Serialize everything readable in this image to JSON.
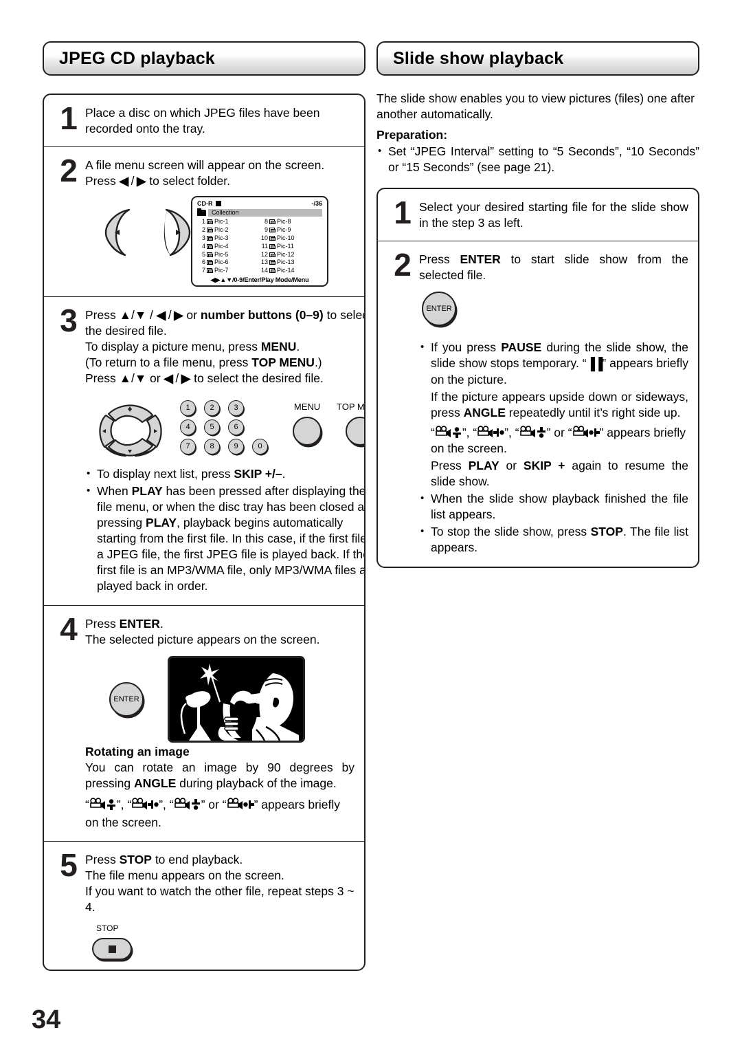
{
  "page_number": "34",
  "left": {
    "header": "JPEG CD playback",
    "steps": [
      {
        "num": "1",
        "lines": [
          "Place a disc on which JPEG files have been recorded onto the tray."
        ]
      },
      {
        "num": "2",
        "line1": "A file menu screen will appear on the screen.",
        "line2_pre": "Press ",
        "line2_post": " to select folder."
      },
      {
        "num": "3",
        "l1a": "Press ",
        "l1b": " / ",
        "l1c": " or ",
        "l1d": "number buttons (0–9)",
        "l1e": " to select the desired file.",
        "l2a": "To display a picture menu, press ",
        "l2b": "MENU",
        "l2c": ".",
        "l3a": "(To return to a file menu, press ",
        "l3b": "TOP MENU",
        "l3c": ".)",
        "l4a": "Press ",
        "l4b": " or ",
        "l4c": " to select the desired file.",
        "bullets": [
          {
            "a": "To display next list, press ",
            "b": "SKIP +/–",
            "c": "."
          },
          {
            "a": "When ",
            "b": "PLAY",
            "c": " has been pressed after displaying the file menu, or when the disc tray has been closed after pressing ",
            "d": "PLAY",
            "e": ", playback begins automatically starting from the first file. In this case, if the first file is a JPEG file, the first JPEG file is played back. If the first file is an MP3/WMA file, only MP3/WMA files are played back in order."
          }
        ]
      },
      {
        "num": "4",
        "l1a": "Press ",
        "l1b": "ENTER",
        "l1c": ".",
        "l2": "The selected picture appears on the screen.",
        "enter_label": "ENTER",
        "rotate_head": "Rotating an image",
        "rotate_t1": "You can rotate an image by 90 degrees by pressing ",
        "rotate_t2": "ANGLE",
        "rotate_t3": " during playback of the image.",
        "rotate_t4": " appears briefly on the screen."
      },
      {
        "num": "5",
        "l1a": "Press ",
        "l1b": "STOP",
        "l1c": " to end playback.",
        "l2": "The file menu appears on the screen.",
        "l3": "If you want to watch the other file, repeat steps 3 ~ 4.",
        "stop_label": "STOP"
      }
    ],
    "osd": {
      "disc_type": "CD-R",
      "counter": "-/36",
      "folder": "Collection",
      "files_left": [
        {
          "idx": "1",
          "name": "Pic-1"
        },
        {
          "idx": "2",
          "name": "Pic-2"
        },
        {
          "idx": "3",
          "name": "Pic-3"
        },
        {
          "idx": "4",
          "name": "Pic-4"
        },
        {
          "idx": "5",
          "name": "Pic-5"
        },
        {
          "idx": "6",
          "name": "Pic-6"
        },
        {
          "idx": "7",
          "name": "Pic-7"
        }
      ],
      "files_right": [
        {
          "idx": "8",
          "name": "Pic-8"
        },
        {
          "idx": "9",
          "name": "Pic-9"
        },
        {
          "idx": "10",
          "name": "Pic-10"
        },
        {
          "idx": "11",
          "name": "Pic-11"
        },
        {
          "idx": "12",
          "name": "Pic-12"
        },
        {
          "idx": "13",
          "name": "Pic-13"
        },
        {
          "idx": "14",
          "name": "Pic-14"
        }
      ],
      "footer": "◀▶▲▼/0-9/Enter/Play Mode/Menu"
    },
    "keypad": {
      "r1": [
        "1",
        "2",
        "3"
      ],
      "r2": [
        "4",
        "5",
        "6"
      ],
      "r3": [
        "7",
        "8",
        "9",
        "0"
      ],
      "menu_label": "MENU",
      "top_menu_label": "TOP MENU"
    }
  },
  "right": {
    "header": "Slide show playback",
    "intro": "The slide show enables you to view pictures (files) one after another automatically.",
    "preparation_label": "Preparation:",
    "preparation_bullet": "Set “JPEG Interval” setting to “5 Seconds”, “10 Seconds” or “15 Seconds” (see page 21).",
    "steps": [
      {
        "num": "1",
        "text": "Select your desired starting file for the slide show in the step 3 as left."
      },
      {
        "num": "2",
        "l1a": "Press ",
        "l1b": "ENTER",
        "l1c": " to start slide show from the selected file.",
        "enter_label": "ENTER"
      }
    ],
    "bullets": {
      "b1a": "If you press ",
      "b1b": "PAUSE",
      "b1c": " during the slide show, the slide show stops temporary. “",
      "b1_glyph": "▐▐",
      "b1d": "” appears briefly on the picture.",
      "b2a": "If the picture appears upside down or sideways, press ",
      "b2b": "ANGLE",
      "b2c": " repeatedly until it’s right side up.",
      "b3_tail": " appears briefly on the screen.",
      "b4a": "Press ",
      "b4b": "PLAY",
      "b4c": " or ",
      "b4d": "SKIP +",
      "b4e": " again to resume the slide show.",
      "b5": "When the slide show playback finished the file list appears.",
      "b6a": "To stop the slide show, press ",
      "b6b": "STOP",
      "b6c": ". The file list appears."
    }
  },
  "glyphs": {
    "quote_open": "“",
    "quote_close": "”",
    "comma": ", ",
    "or": " or "
  },
  "colors": {
    "ink": "#231f20",
    "button_face": "#d5d5d5",
    "osd_highlight": "#b9b9b9"
  }
}
